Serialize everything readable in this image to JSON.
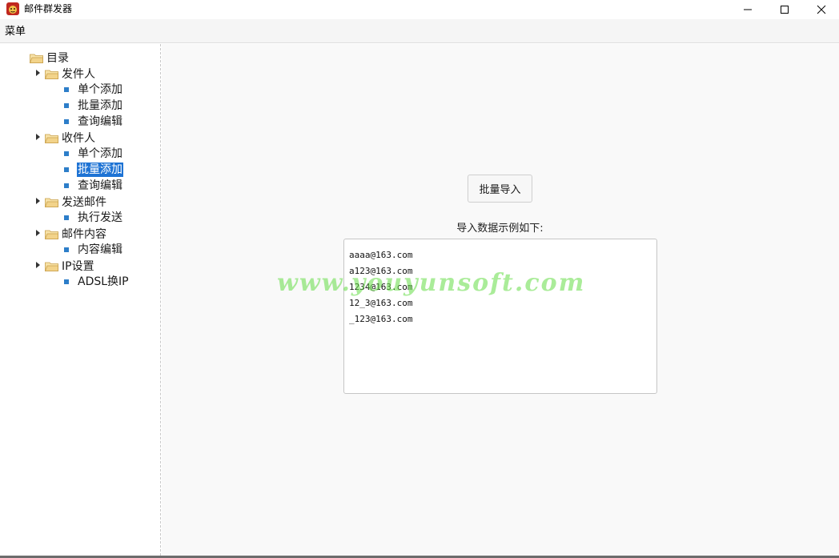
{
  "window": {
    "title": "邮件群发器",
    "controls": {
      "minimize": "minimize",
      "maximize": "maximize",
      "close": "close"
    }
  },
  "menubar": {
    "menu_label": "菜单"
  },
  "tree": {
    "root": "目录",
    "groups": [
      {
        "label": "发件人",
        "children": [
          "单个添加",
          "批量添加",
          "查询编辑"
        ]
      },
      {
        "label": "收件人",
        "children": [
          "单个添加",
          "批量添加",
          "查询编辑"
        ]
      },
      {
        "label": "发送邮件",
        "children": [
          "执行发送"
        ]
      },
      {
        "label": "邮件内容",
        "children": [
          "内容编辑"
        ]
      },
      {
        "label": "IP设置",
        "children": [
          "ADSL换IP"
        ]
      }
    ],
    "selected": "收件人/批量添加"
  },
  "main": {
    "import_button": "批量导入",
    "example_label": "导入数据示例如下:",
    "example_lines": [
      "aaaa@163.com",
      "a123@163.com",
      "1234@163.com",
      "12_3@163.com",
      "_123@163.com"
    ]
  },
  "watermark": "www.youyunsoft.com",
  "colors": {
    "accent": "#1e73d4",
    "bullet": "#2d7ec9",
    "folder": "#f2d38a",
    "watermark": "#64dc46"
  }
}
